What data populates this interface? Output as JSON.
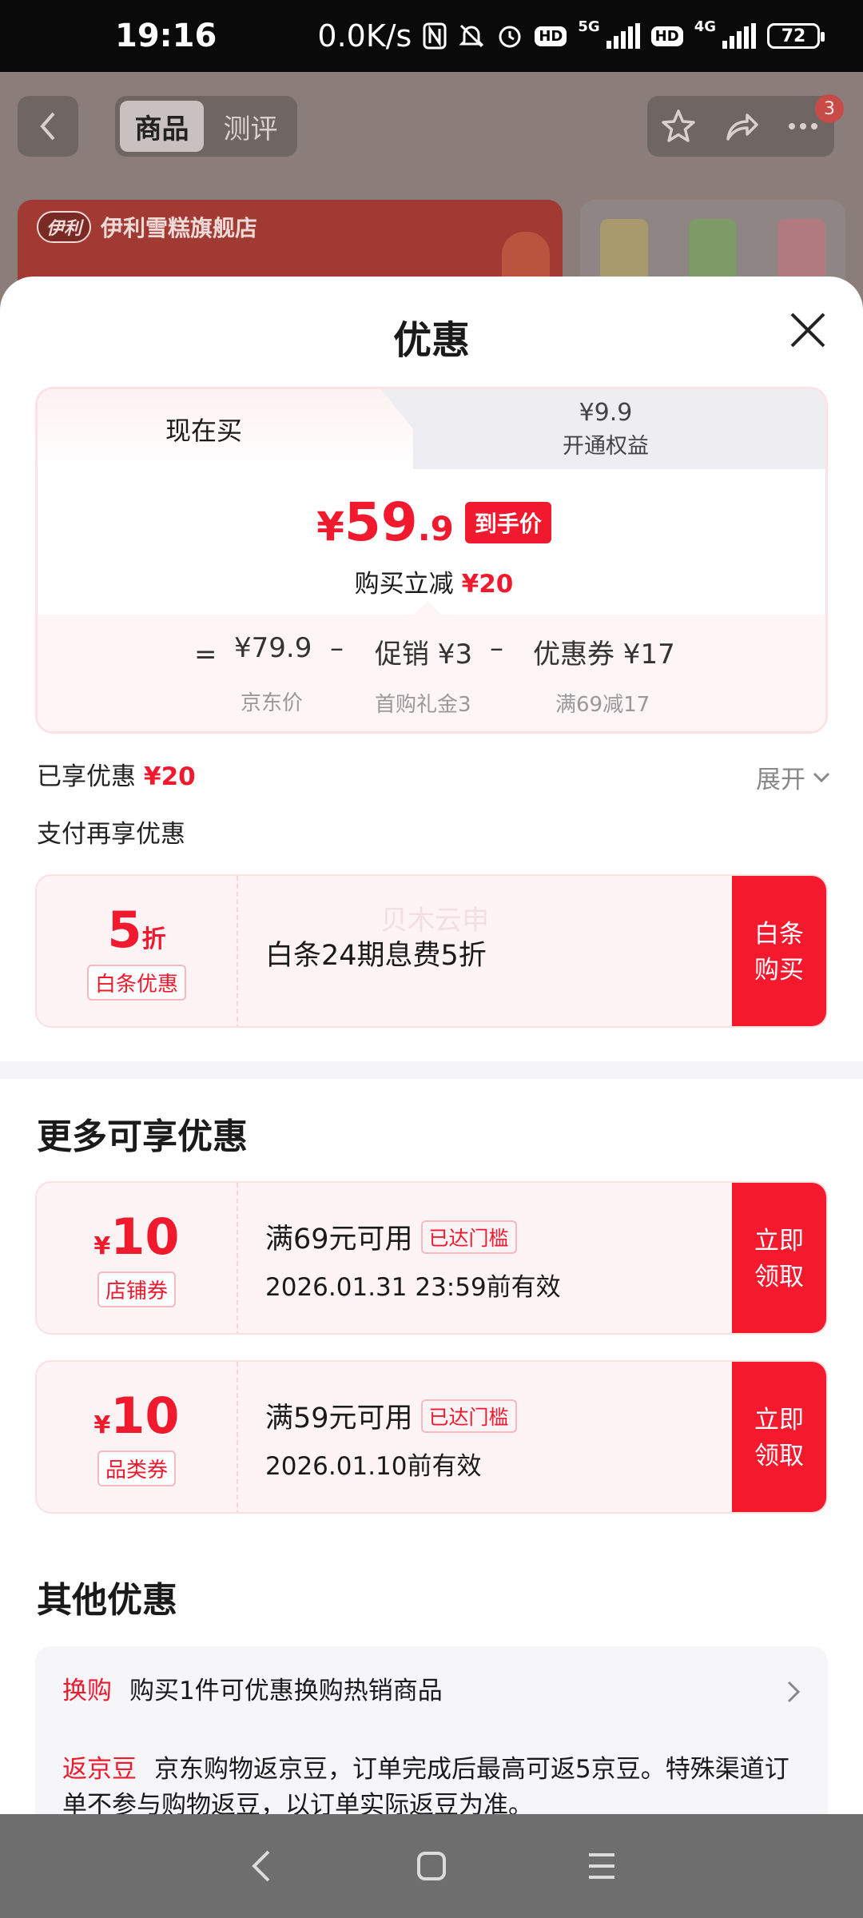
{
  "status_bar": {
    "time": "19:16",
    "net_speed": "0.0K/s",
    "net1": "5G",
    "net2": "4G",
    "hd": "HD",
    "battery": "72"
  },
  "bg_page": {
    "tabs": [
      "商品",
      "测评"
    ],
    "badge": "3",
    "store_name": "伊利雪糕旗舰店",
    "logo_text": "伊利"
  },
  "sheet": {
    "title": "优惠",
    "tab_now": "现在买",
    "tab_other_price": "¥9.9",
    "tab_other_label": "开通权益",
    "price_yen": "¥",
    "price_int": "59",
    "price_dec": ".9",
    "price_tag": "到手价",
    "save_label": "购买立减",
    "save_amount": "¥20",
    "breakdown": {
      "eq": "=",
      "jd_price": "¥79.9",
      "jd_price_label": "京东价",
      "minus1": "–",
      "promo": "促销 ¥3",
      "promo_label": "首购礼金3",
      "minus2": "–",
      "coupon": "优惠券 ¥17",
      "coupon_label": "满69减17"
    },
    "enjoyed_label": "已享优惠",
    "enjoyed_amount": "¥20",
    "expand": "展开",
    "pay_title": "支付再享优惠",
    "baitiao": {
      "amount": "5",
      "unit": "折",
      "tag": "白条优惠",
      "desc": "白条24期息费5折",
      "btn": "白条购买",
      "watermark": "贝木云申"
    },
    "more_title": "更多可享优惠",
    "coupons": [
      {
        "yen": "¥",
        "amount": "10",
        "tag": "店铺券",
        "cond": "满69元可用",
        "reached": "已达门槛",
        "date": "2026.01.31 23:59前有效",
        "btn": "立即领取"
      },
      {
        "yen": "¥",
        "amount": "10",
        "tag": "品类券",
        "cond": "满59元可用",
        "reached": "已达门槛",
        "date": "2026.01.10前有效",
        "btn": "立即领取"
      }
    ],
    "other_title": "其他优惠",
    "other": [
      {
        "key": "换购",
        "text": "购买1件可优惠换购热销商品"
      },
      {
        "key": "返京豆",
        "text": "京东购物返京豆，订单完成后最高可返5京豆。特殊渠道订单不参与购物返豆，以订单实际返豆为准。"
      }
    ]
  },
  "colors": {
    "accent": "#f0192e",
    "accent_light": "#fef4f5",
    "nav_bg": "#6e6e6e"
  },
  "icons": {
    "close": "close-icon",
    "back": "back-icon",
    "star": "star-icon",
    "share": "share-icon",
    "more": "more-icon",
    "chevron_down": "chevron-down-icon",
    "chevron_right": "chevron-right-icon"
  }
}
